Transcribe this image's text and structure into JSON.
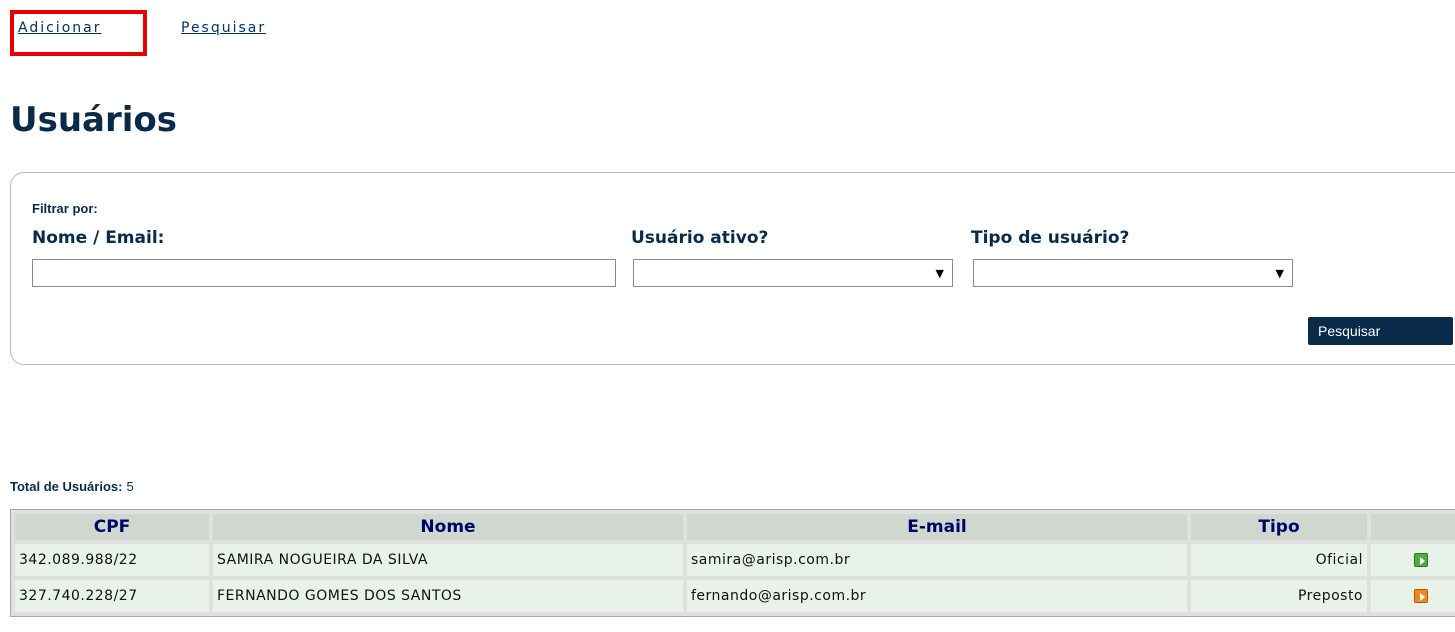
{
  "nav": {
    "adicionar": "Adicionar",
    "pesquisar": "Pesquisar"
  },
  "page": {
    "title": "Usuários"
  },
  "filter": {
    "title": "Filtrar por:",
    "nome_label": "Nome / Email:",
    "nome_value": "",
    "ativo_label": "Usuário ativo?",
    "ativo_value": "",
    "tipo_label": "Tipo de usuário?",
    "tipo_value": "",
    "search_button": "Pesquisar"
  },
  "summary": {
    "label": "Total de Usuários:",
    "count": "5"
  },
  "table": {
    "headers": [
      "CPF",
      "Nome",
      "E-mail",
      "Tipo"
    ],
    "rows": [
      {
        "cpf": "342.089.988/22",
        "nome": "SAMIRA NOGUEIRA DA SILVA",
        "email": "samira@arisp.com.br",
        "tipo": "Oficial",
        "status_icon": "play-green-icon"
      },
      {
        "cpf": "327.740.228/27",
        "nome": "FERNANDO GOMES DOS SANTOS",
        "email": "fernando@arisp.com.br",
        "tipo": "Preposto",
        "status_icon": "play-orange-icon"
      }
    ]
  },
  "colors": {
    "title": "#0a2a4a",
    "highlight": "#e60000",
    "table_header_text": "#000066",
    "row_bg": "#e8f2e8"
  }
}
